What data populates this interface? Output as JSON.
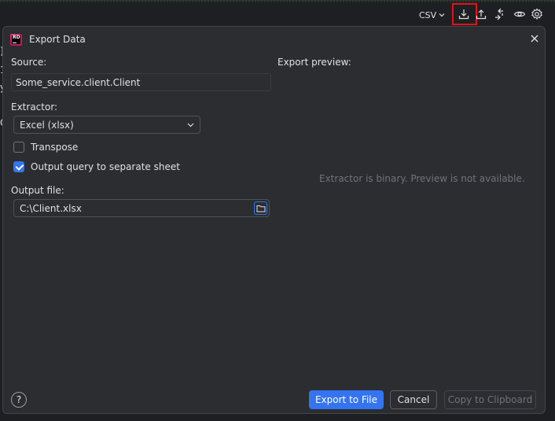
{
  "toolbar": {
    "format_label": "CSV",
    "icons": [
      "download-icon",
      "upload-icon",
      "compare-icon",
      "eye-icon",
      "gear-icon"
    ]
  },
  "background_fragments": [
    "]",
    "1",
    "y",
    "C"
  ],
  "dialog": {
    "title": "Export Data",
    "logo_text": "RD",
    "source_label": "Source:",
    "source_value": "Some_service.client.Client",
    "extractor_label": "Extractor:",
    "extractor_value": "Excel (xlsx)",
    "transpose_label": "Transpose",
    "transpose_checked": false,
    "separate_sheet_label": "Output query to separate sheet",
    "separate_sheet_checked": true,
    "output_file_label": "Output file:",
    "output_file_value": "C:\\Client.xlsx",
    "preview_label": "Export preview:",
    "preview_message": "Extractor is binary. Preview is not available.",
    "help_label": "?",
    "export_button": "Export to File",
    "cancel_button": "Cancel",
    "copy_button": "Copy to Clipboard"
  },
  "colors": {
    "accent": "#3574f0",
    "highlight": "#e0141a",
    "background": "#1e1f22",
    "dialog": "#2b2d30"
  }
}
